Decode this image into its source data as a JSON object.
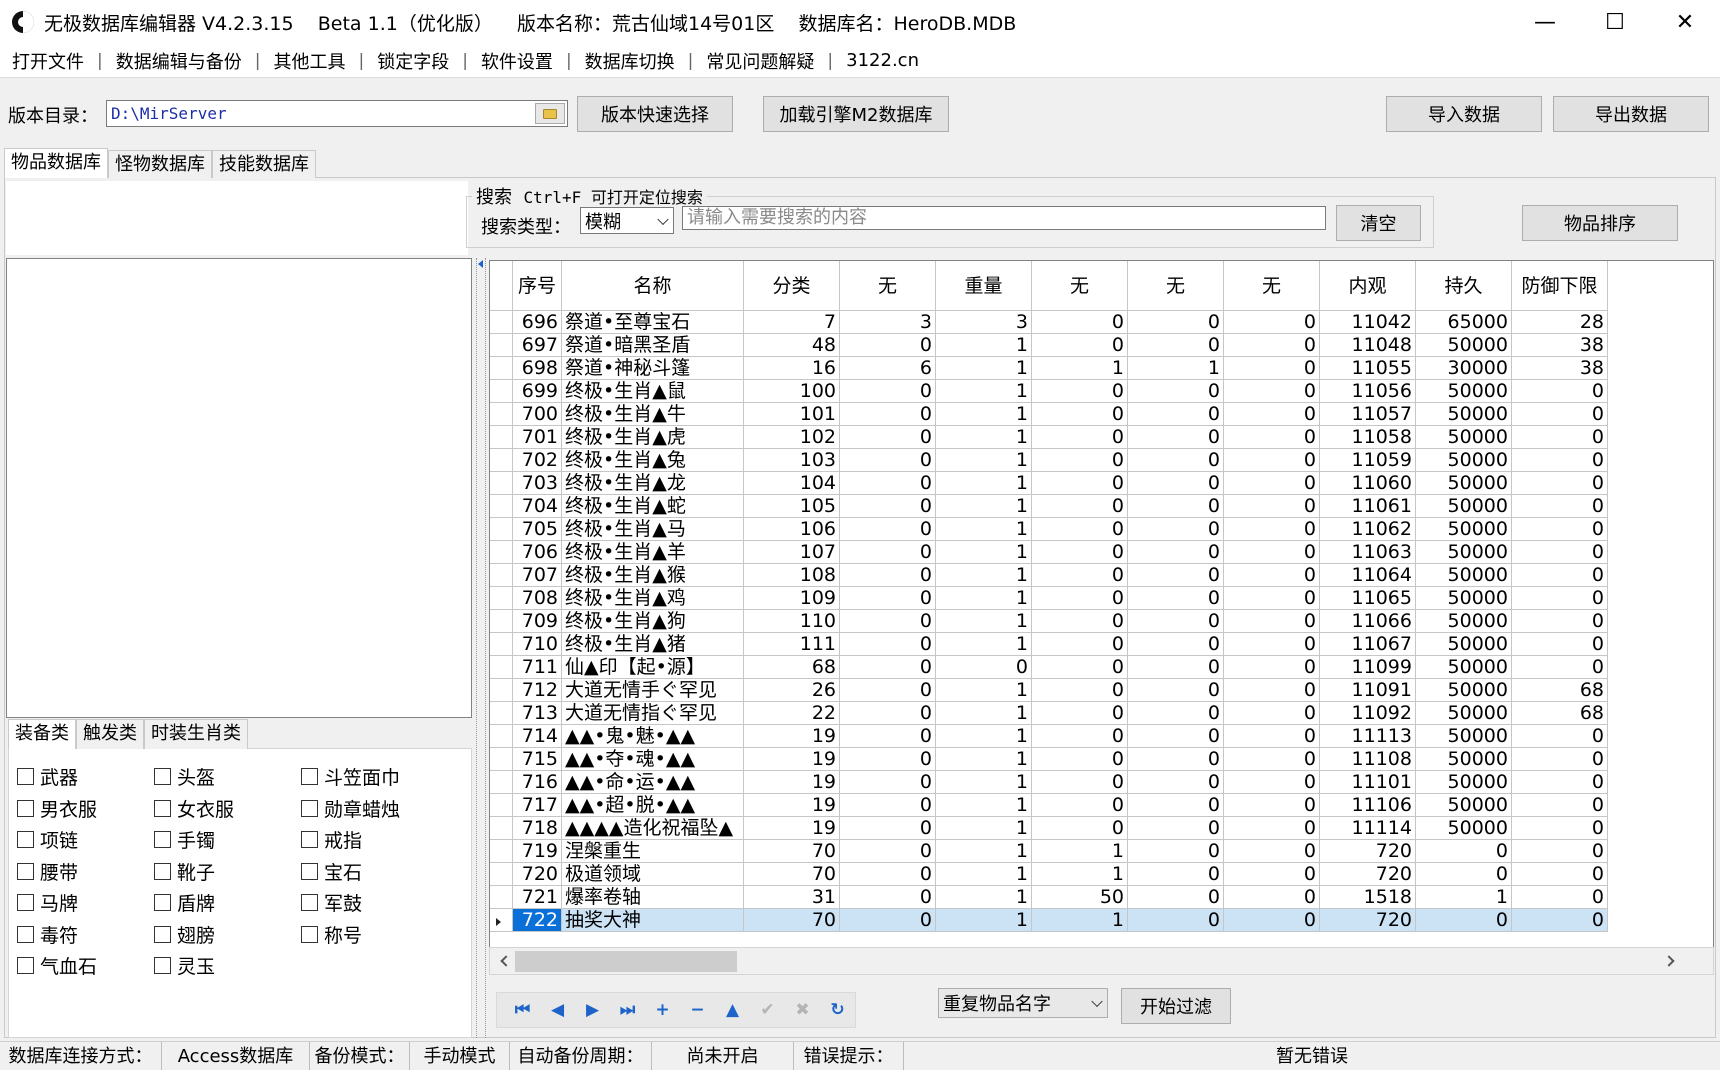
{
  "window": {
    "title": "无极数据库编辑器 V4.2.3.15    Beta 1.1（优化版）    版本名称：荒古仙域14号01区    数据库名：HeroDB.MDB",
    "minimize": "—",
    "maximize": "☐",
    "close": "✕"
  },
  "menu": [
    "打开文件",
    "数据编辑与备份",
    "其他工具",
    "锁定字段",
    "软件设置",
    "数据库切换",
    "常见问题解疑",
    "3122.cn"
  ],
  "menu_sep": "|",
  "toolbar": {
    "dir_label": "版本目录：",
    "dir_value": "D:\\MirServer",
    "quick_select": "版本快速选择",
    "load_m2": "加载引擎M2数据库",
    "import": "导入数据",
    "export": "导出数据"
  },
  "tabs": [
    "物品数据库",
    "怪物数据库",
    "技能数据库"
  ],
  "search": {
    "title_word": "搜索",
    "title_hint": "Ctrl+F 可打开定位搜索",
    "type_label": "搜索类型：",
    "type_value": "模糊",
    "placeholder": "请输入需要搜索的内容",
    "clear": "清空",
    "sort": "物品排序"
  },
  "category_tabs": [
    "装备类",
    "触发类",
    "时装生肖类"
  ],
  "checkboxes": [
    [
      "武器",
      "头盔",
      "斗笠面巾"
    ],
    [
      "男衣服",
      "女衣服",
      "勋章蜡烛"
    ],
    [
      "项链",
      "手镯",
      "戒指"
    ],
    [
      "腰带",
      "靴子",
      "宝石"
    ],
    [
      "马牌",
      "盾牌",
      "军鼓"
    ],
    [
      "毒符",
      "翅膀",
      "称号"
    ],
    [
      "气血石",
      "灵玉",
      ""
    ]
  ],
  "grid": {
    "columns": [
      "序号",
      "名称",
      "分类",
      "无",
      "重量",
      "无",
      "无",
      "无",
      "内观",
      "持久",
      "防御下限"
    ],
    "rows": [
      [
        "696",
        "祭道•至尊宝石",
        "7",
        "3",
        "3",
        "0",
        "0",
        "0",
        "11042",
        "65000",
        "28"
      ],
      [
        "697",
        "祭道•暗黑圣盾",
        "48",
        "0",
        "1",
        "0",
        "0",
        "0",
        "11048",
        "50000",
        "38"
      ],
      [
        "698",
        "祭道•神秘斗篷",
        "16",
        "6",
        "1",
        "1",
        "1",
        "0",
        "11055",
        "30000",
        "38"
      ],
      [
        "699",
        "终极•生肖▲鼠",
        "100",
        "0",
        "1",
        "0",
        "0",
        "0",
        "11056",
        "50000",
        "0"
      ],
      [
        "700",
        "终极•生肖▲牛",
        "101",
        "0",
        "1",
        "0",
        "0",
        "0",
        "11057",
        "50000",
        "0"
      ],
      [
        "701",
        "终极•生肖▲虎",
        "102",
        "0",
        "1",
        "0",
        "0",
        "0",
        "11058",
        "50000",
        "0"
      ],
      [
        "702",
        "终极•生肖▲兔",
        "103",
        "0",
        "1",
        "0",
        "0",
        "0",
        "11059",
        "50000",
        "0"
      ],
      [
        "703",
        "终极•生肖▲龙",
        "104",
        "0",
        "1",
        "0",
        "0",
        "0",
        "11060",
        "50000",
        "0"
      ],
      [
        "704",
        "终极•生肖▲蛇",
        "105",
        "0",
        "1",
        "0",
        "0",
        "0",
        "11061",
        "50000",
        "0"
      ],
      [
        "705",
        "终极•生肖▲马",
        "106",
        "0",
        "1",
        "0",
        "0",
        "0",
        "11062",
        "50000",
        "0"
      ],
      [
        "706",
        "终极•生肖▲羊",
        "107",
        "0",
        "1",
        "0",
        "0",
        "0",
        "11063",
        "50000",
        "0"
      ],
      [
        "707",
        "终极•生肖▲猴",
        "108",
        "0",
        "1",
        "0",
        "0",
        "0",
        "11064",
        "50000",
        "0"
      ],
      [
        "708",
        "终极•生肖▲鸡",
        "109",
        "0",
        "1",
        "0",
        "0",
        "0",
        "11065",
        "50000",
        "0"
      ],
      [
        "709",
        "终极•生肖▲狗",
        "110",
        "0",
        "1",
        "0",
        "0",
        "0",
        "11066",
        "50000",
        "0"
      ],
      [
        "710",
        "终极•生肖▲猪",
        "111",
        "0",
        "1",
        "0",
        "0",
        "0",
        "11067",
        "50000",
        "0"
      ],
      [
        "711",
        "仙▲印【起•源】",
        "68",
        "0",
        "0",
        "0",
        "0",
        "0",
        "11099",
        "50000",
        "0"
      ],
      [
        "712",
        "大道无情手ぐ罕见",
        "26",
        "0",
        "1",
        "0",
        "0",
        "0",
        "11091",
        "50000",
        "68"
      ],
      [
        "713",
        "大道无情指ぐ罕见",
        "22",
        "0",
        "1",
        "0",
        "0",
        "0",
        "11092",
        "50000",
        "68"
      ],
      [
        "714",
        "▲▲•鬼•魅•▲▲",
        "19",
        "0",
        "1",
        "0",
        "0",
        "0",
        "11113",
        "50000",
        "0"
      ],
      [
        "715",
        "▲▲•夺•魂•▲▲",
        "19",
        "0",
        "1",
        "0",
        "0",
        "0",
        "11108",
        "50000",
        "0"
      ],
      [
        "716",
        "▲▲•命•运•▲▲",
        "19",
        "0",
        "1",
        "0",
        "0",
        "0",
        "11101",
        "50000",
        "0"
      ],
      [
        "717",
        "▲▲•超•脱•▲▲",
        "19",
        "0",
        "1",
        "0",
        "0",
        "0",
        "11106",
        "50000",
        "0"
      ],
      [
        "718",
        "▲▲▲▲造化祝福坠▲",
        "19",
        "0",
        "1",
        "0",
        "0",
        "0",
        "11114",
        "50000",
        "0"
      ],
      [
        "719",
        "涅槃重生",
        "70",
        "0",
        "1",
        "1",
        "0",
        "0",
        "720",
        "0",
        "0"
      ],
      [
        "720",
        "极道领域",
        "70",
        "0",
        "1",
        "1",
        "0",
        "0",
        "720",
        "0",
        "0"
      ],
      [
        "721",
        "爆率卷轴",
        "31",
        "0",
        "1",
        "50",
        "0",
        "0",
        "1518",
        "1",
        "0"
      ],
      [
        "722",
        "抽奖大神",
        "70",
        "0",
        "1",
        "1",
        "0",
        "0",
        "720",
        "0",
        "0"
      ]
    ],
    "selected_index": 26
  },
  "navigator": [
    {
      "icon": "first-record-icon",
      "glyph": "⏮",
      "enabled": true
    },
    {
      "icon": "prior-record-icon",
      "glyph": "◀",
      "enabled": true
    },
    {
      "icon": "next-record-icon",
      "glyph": "▶",
      "enabled": true
    },
    {
      "icon": "last-record-icon",
      "glyph": "⏭",
      "enabled": true
    },
    {
      "icon": "insert-record-icon",
      "glyph": "+",
      "enabled": true
    },
    {
      "icon": "delete-record-icon",
      "glyph": "−",
      "enabled": true
    },
    {
      "icon": "edit-record-icon",
      "glyph": "▲",
      "enabled": true
    },
    {
      "icon": "post-record-icon",
      "glyph": "✔",
      "enabled": false
    },
    {
      "icon": "cancel-record-icon",
      "glyph": "✖",
      "enabled": false
    },
    {
      "icon": "refresh-record-icon",
      "glyph": "↻",
      "enabled": true
    }
  ],
  "filter": {
    "select_value": "重复物品名字",
    "start": "开始过滤"
  },
  "status": {
    "conn_label": "数据库连接方式：",
    "conn_value": "Access数据库",
    "backup_label": "备份模式：",
    "backup_value": "手动模式",
    "auto_label": "自动备份周期：",
    "auto_value": "尚未开启",
    "err_label": "错误提示：",
    "err_value": "暂无错误"
  },
  "colors": {
    "selected_row": "#cce3f6",
    "selected_cell": "#0a6fd7",
    "nav_blue": "#1e63c9",
    "path_text": "#1c2fa8"
  }
}
